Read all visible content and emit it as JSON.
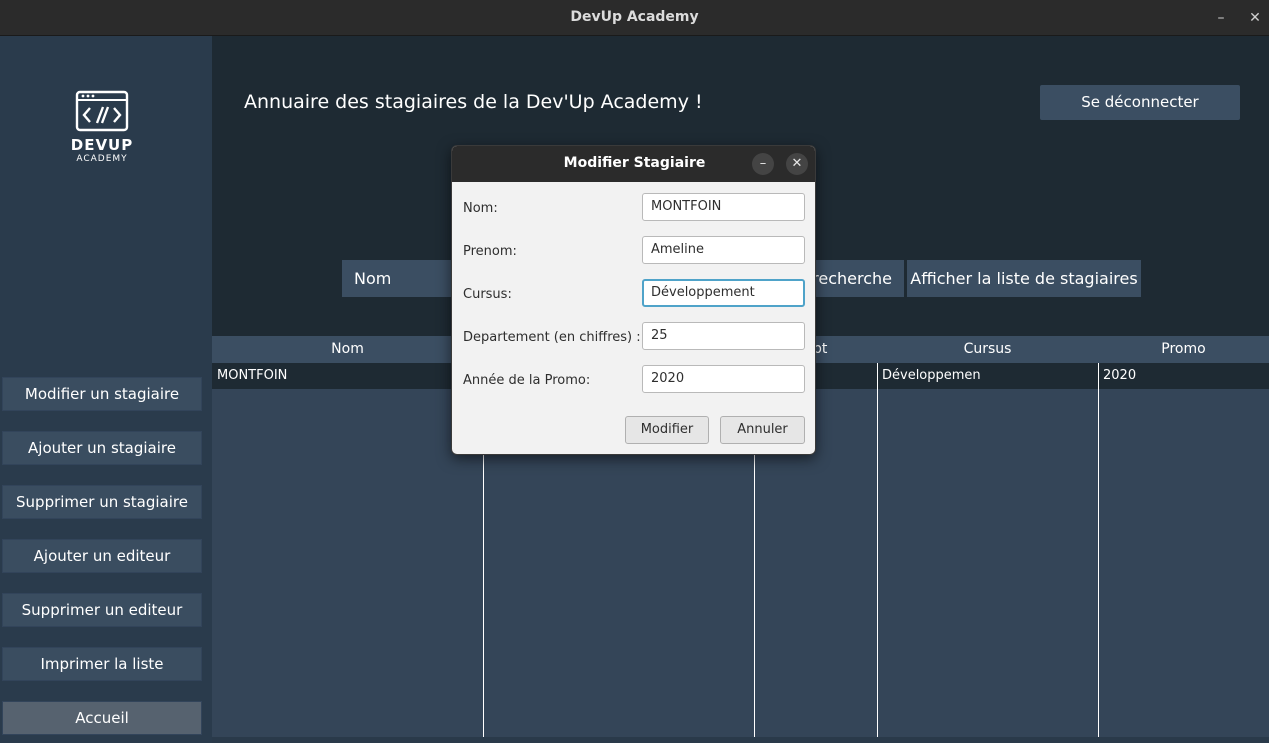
{
  "window": {
    "title": "DevUp Academy",
    "minimize_glyph": "–",
    "close_glyph": "✕"
  },
  "logo": {
    "line1": "DEVUP",
    "line2": "ACADEMY",
    "icon": "code-window-icon"
  },
  "sidebar": {
    "items": [
      {
        "label": "Modifier un stagiaire"
      },
      {
        "label": "Ajouter un stagiaire"
      },
      {
        "label": "Supprimer un stagiaire"
      },
      {
        "label": "Ajouter un editeur"
      },
      {
        "label": "Supprimer un editeur"
      },
      {
        "label": "Imprimer la liste"
      },
      {
        "label": "Accueil"
      }
    ]
  },
  "header": {
    "title": "Annuaire des stagiaires de la Dev'Up Academy !",
    "logout_label": "Se déconnecter"
  },
  "search": {
    "field_text": "Nom",
    "button_label": "recherche",
    "list_button_label": "Afficher la liste de stagiaires"
  },
  "table": {
    "columns": [
      "Nom",
      "pt",
      "Cursus",
      "Promo"
    ],
    "rows": [
      {
        "nom": "MONTFOIN",
        "cursus": "Développemen",
        "promo": "2020"
      }
    ]
  },
  "dialog": {
    "title": "Modifier Stagiaire",
    "fields": [
      {
        "label": "Nom:",
        "value": "MONTFOIN"
      },
      {
        "label": "Prenom:",
        "value": "Ameline"
      },
      {
        "label": "Cursus:",
        "value": "Développement"
      },
      {
        "label": "Departement (en chiffres) :",
        "value": "25"
      },
      {
        "label": "Année de la Promo:",
        "value": "2020"
      }
    ],
    "submit_label": "Modifier",
    "cancel_label": "Annuler",
    "minimize_glyph": "–",
    "close_glyph": "✕"
  },
  "colors": {
    "sidebar_bg": "#2a3b4c",
    "main_bg": "#1e2a33",
    "button_bg": "#3b4e62",
    "focus_accent": "#4fa3c9"
  }
}
